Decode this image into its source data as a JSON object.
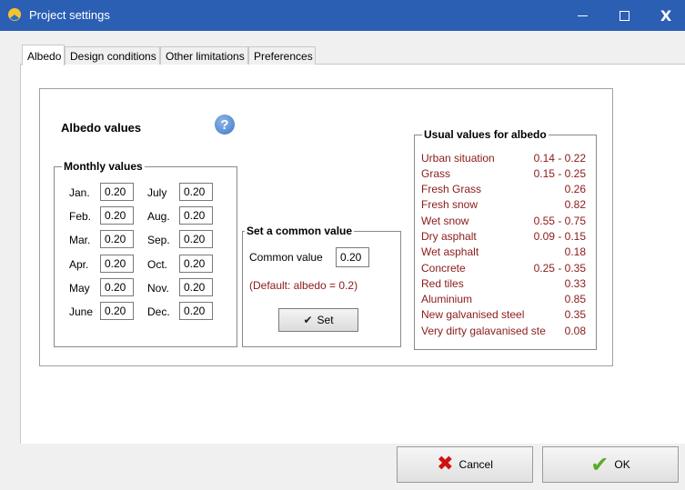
{
  "window": {
    "title": "Project settings"
  },
  "colors": {
    "titlebar": "#2b5fb4",
    "accent_text": "#8b1a1a"
  },
  "icons": {
    "app": "sun-icon",
    "help": "help-icon",
    "cancel": "red-x-icon",
    "ok": "green-check-icon",
    "set": "check-icon"
  },
  "tabs": [
    "Albedo",
    "Design conditions",
    "Other limitations",
    "Preferences"
  ],
  "active_tab": "Albedo",
  "albedo": {
    "title": "Albedo values",
    "help": "?",
    "monthly_label": "Monthly values",
    "months_left": [
      {
        "label": "Jan.",
        "value": "0.20"
      },
      {
        "label": "Feb.",
        "value": "0.20"
      },
      {
        "label": "Mar.",
        "value": "0.20"
      },
      {
        "label": "Apr.",
        "value": "0.20"
      },
      {
        "label": "May",
        "value": "0.20"
      },
      {
        "label": "June",
        "value": "0.20"
      }
    ],
    "months_right": [
      {
        "label": "July",
        "value": "0.20"
      },
      {
        "label": "Aug.",
        "value": "0.20"
      },
      {
        "label": "Sep.",
        "value": "0.20"
      },
      {
        "label": "Oct.",
        "value": "0.20"
      },
      {
        "label": "Nov.",
        "value": "0.20"
      },
      {
        "label": "Dec.",
        "value": "0.20"
      }
    ],
    "common": {
      "group_label": "Set a common value",
      "label": "Common value",
      "value": "0.20",
      "note": "(Default: albedo = 0.2)",
      "button": "Set"
    },
    "usual": {
      "group_label": "Usual values for albedo",
      "rows": [
        {
          "name": "Urban situation",
          "value": "0.14 - 0.22"
        },
        {
          "name": "Grass",
          "value": "0.15 - 0.25"
        },
        {
          "name": "Fresh Grass",
          "value": "0.26"
        },
        {
          "name": "Fresh snow",
          "value": "0.82"
        },
        {
          "name": "Wet snow",
          "value": "0.55 - 0.75"
        },
        {
          "name": "Dry asphalt",
          "value": "0.09 - 0.15"
        },
        {
          "name": "Wet asphalt",
          "value": "0.18"
        },
        {
          "name": "Concrete",
          "value": "0.25 - 0.35"
        },
        {
          "name": "Red tiles",
          "value": "0.33"
        },
        {
          "name": "Aluminium",
          "value": "0.85"
        },
        {
          "name": "New galvanised steel",
          "value": "0.35"
        },
        {
          "name": "Very dirty galavanised ste",
          "value": "0.08"
        }
      ]
    }
  },
  "buttons": {
    "cancel": "Cancel",
    "ok": "OK"
  }
}
